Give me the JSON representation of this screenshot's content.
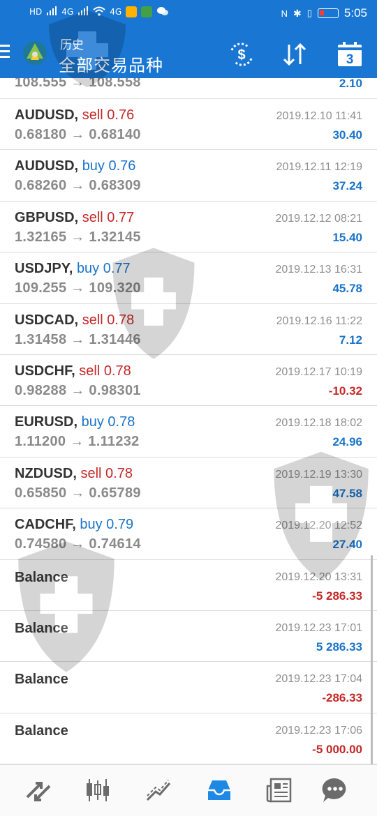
{
  "status_bar": {
    "hd1": "HD",
    "sig1": "4G",
    "sig2": "4G",
    "wifi": "wifi",
    "time": "5:05"
  },
  "header": {
    "subtitle": "历史",
    "title": "全部交易品种",
    "calendar_day": "3",
    "icons": [
      "menu-icon",
      "app-logo",
      "currency-exchange-icon",
      "sort-icon",
      "calendar-icon"
    ]
  },
  "partial_row": {
    "prices": "108.555 → 108.558",
    "profit": "2.10"
  },
  "trades": [
    {
      "symbol": "AUDUSD,",
      "side": "sell",
      "volume": "0.76",
      "prices": "0.68180 → 0.68140",
      "datetime": "2019.12.10 11:41",
      "profit": "30.40",
      "sign": "pos"
    },
    {
      "symbol": "AUDUSD,",
      "side": "buy",
      "volume": "0.76",
      "prices": "0.68260 → 0.68309",
      "datetime": "2019.12.11 12:19",
      "profit": "37.24",
      "sign": "pos"
    },
    {
      "symbol": "GBPUSD,",
      "side": "sell",
      "volume": "0.77",
      "prices": "1.32165 → 1.32145",
      "datetime": "2019.12.12 08:21",
      "profit": "15.40",
      "sign": "pos"
    },
    {
      "symbol": "USDJPY,",
      "side": "buy",
      "volume": "0.77",
      "prices": "109.255 → 109.320",
      "datetime": "2019.12.13 16:31",
      "profit": "45.78",
      "sign": "pos"
    },
    {
      "symbol": "USDCAD,",
      "side": "sell",
      "volume": "0.78",
      "prices": "1.31458 → 1.31446",
      "datetime": "2019.12.16 11:22",
      "profit": "7.12",
      "sign": "pos"
    },
    {
      "symbol": "USDCHF,",
      "side": "sell",
      "volume": "0.78",
      "prices": "0.98288 → 0.98301",
      "datetime": "2019.12.17 10:19",
      "profit": "-10.32",
      "sign": "neg"
    },
    {
      "symbol": "EURUSD,",
      "side": "buy",
      "volume": "0.78",
      "prices": "1.11200 → 1.11232",
      "datetime": "2019.12.18 18:02",
      "profit": "24.96",
      "sign": "pos"
    },
    {
      "symbol": "NZDUSD,",
      "side": "sell",
      "volume": "0.78",
      "prices": "0.65850 → 0.65789",
      "datetime": "2019.12.19 13:30",
      "profit": "47.58",
      "sign": "pos"
    },
    {
      "symbol": "CADCHF,",
      "side": "buy",
      "volume": "0.79",
      "prices": "0.74580 → 0.74614",
      "datetime": "2019.12.20 12:52",
      "profit": "27.40",
      "sign": "pos"
    }
  ],
  "balances": [
    {
      "label": "Balance",
      "datetime": "2019.12.20 13:31",
      "amount": "-5 286.33",
      "sign": "neg"
    },
    {
      "label": "Balance",
      "datetime": "2019.12.23 17:01",
      "amount": "5 286.33",
      "sign": "pos"
    },
    {
      "label": "Balance",
      "datetime": "2019.12.23 17:04",
      "amount": "-286.33",
      "sign": "neg"
    },
    {
      "label": "Balance",
      "datetime": "2019.12.23 17:06",
      "amount": "-5 000.00",
      "sign": "neg"
    }
  ],
  "bottom_nav": [
    "quotes-icon",
    "chart-icon",
    "trade-icon",
    "history-icon",
    "news-icon",
    "chat-icon"
  ],
  "colors": {
    "header_blue": "#1976d2",
    "sell_red": "#c62828",
    "buy_blue": "#1a73c9",
    "active_tab": "#1e88e5",
    "inactive_tab": "#6b6b6b"
  }
}
